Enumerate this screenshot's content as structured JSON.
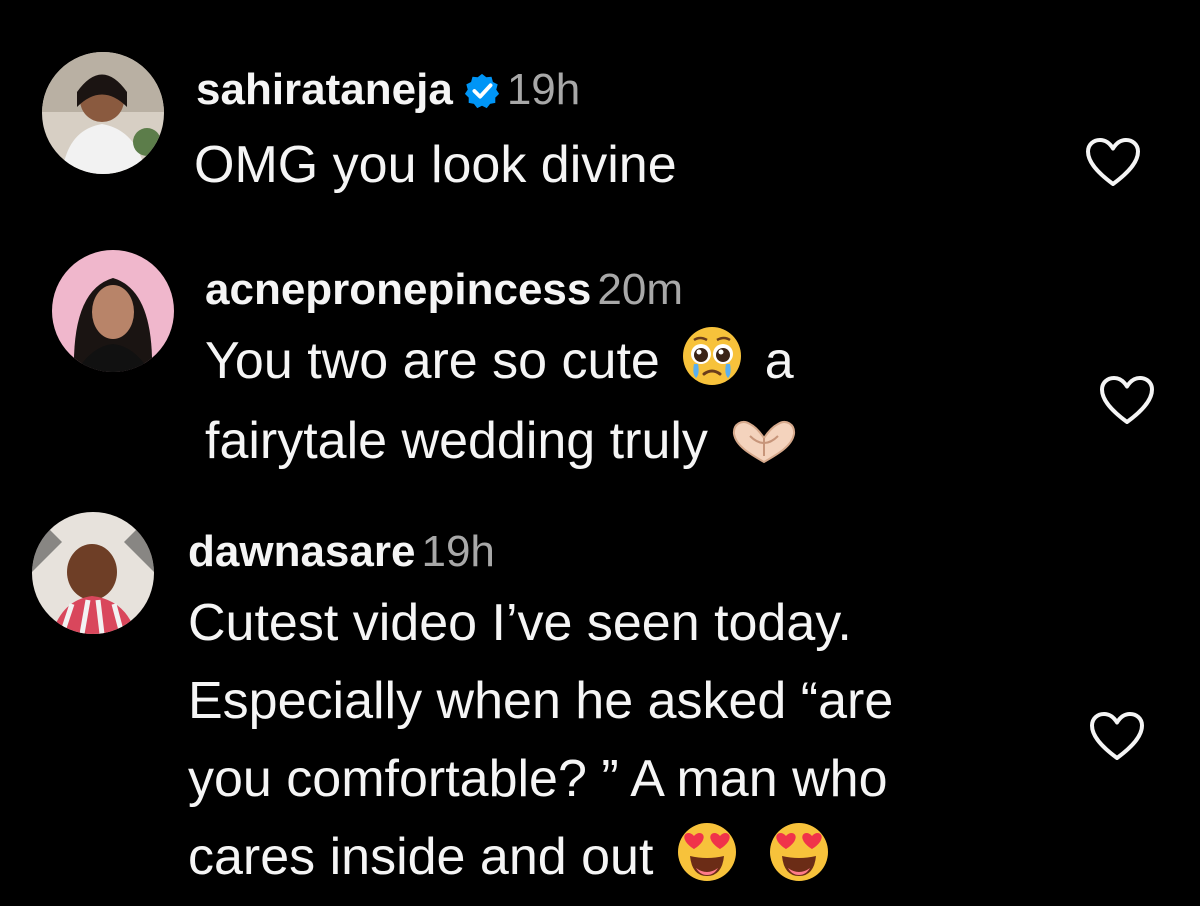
{
  "comments": [
    {
      "username": "sahirataneja",
      "verified": true,
      "time": "19h",
      "lines": [
        "OMG you look divine"
      ]
    },
    {
      "username": "acnepronepincess",
      "time": "20m",
      "line1_before": "You two are so cute",
      "line1_emoji": "pleading-face-emoji",
      "line1_after": "a",
      "line2_before": "fairytale wedding truly",
      "line2_emoji": "heart-hands-emoji"
    },
    {
      "username": "dawnasare",
      "time": "19h",
      "lines": [
        "Cutest video I’ve seen today.",
        "Especially when he asked “are",
        "you comfortable? ” A man who",
        "cares inside and out"
      ],
      "last_line_emojis": [
        "heart-eyes-emoji",
        "heart-eyes-emoji"
      ]
    }
  ],
  "colors": {
    "background": "#000000",
    "text": "#f5f5f5",
    "secondary": "#a8a8a8",
    "verified": "#0095f6"
  }
}
